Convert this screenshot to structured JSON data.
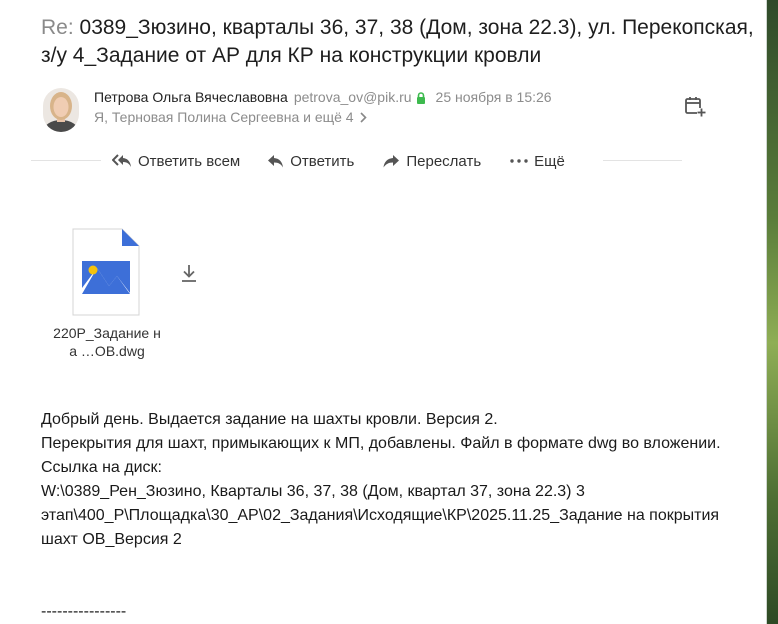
{
  "subject": {
    "prefix": "Re:",
    "text": " 0389_Зюзино, кварталы 36, 37, 38 (Дом, зона 22.3), ул. Перекопская, з/у 4_Задание от АР для КР на конструкции кровли"
  },
  "sender": {
    "name": "Петрова Ольга Вячеславовна",
    "email": "petrova_ov@pik.ru",
    "date": "25 ноября в 15:26",
    "recipients": "Я, Терновая Полина Сергеевна и ещё 4"
  },
  "toolbar": {
    "reply_all": "Ответить всем",
    "reply": "Ответить",
    "forward": "Переслать",
    "more": "Ещё"
  },
  "attachment": {
    "file_name": "220Р_Задание на …ОВ.dwg"
  },
  "body": {
    "line1": "Добрый день. Выдается задание на шахты кровли. Версия 2.",
    "line2": "Перекрытия для шахт, примыкающих к МП, добавлены. Файл в формате dwg во вложении.",
    "line3": "Ссылка на диск:",
    "line4": "W:\\0389_Рен_Зюзино, Кварталы 36, 37, 38 (Дом, квартал 37, зона 22.3) 3 этап\\400_Р\\Площадка\\30_АР\\02_Задания\\Исходящие\\КР\\2025.11.25_Задание на покрытия шахт ОВ_Версия 2",
    "separator": "----------------"
  },
  "colors": {
    "lock_green": "#3dba4e",
    "file_blue": "#3d6fd8",
    "file_sun": "#f4c20d",
    "muted_text": "#8c8c8c"
  },
  "icons": [
    "reply-all-icon",
    "reply-icon",
    "forward-icon",
    "more-icon",
    "lock-icon",
    "chevron-right-icon",
    "calendar-add-icon",
    "download-icon",
    "image-file-icon"
  ]
}
